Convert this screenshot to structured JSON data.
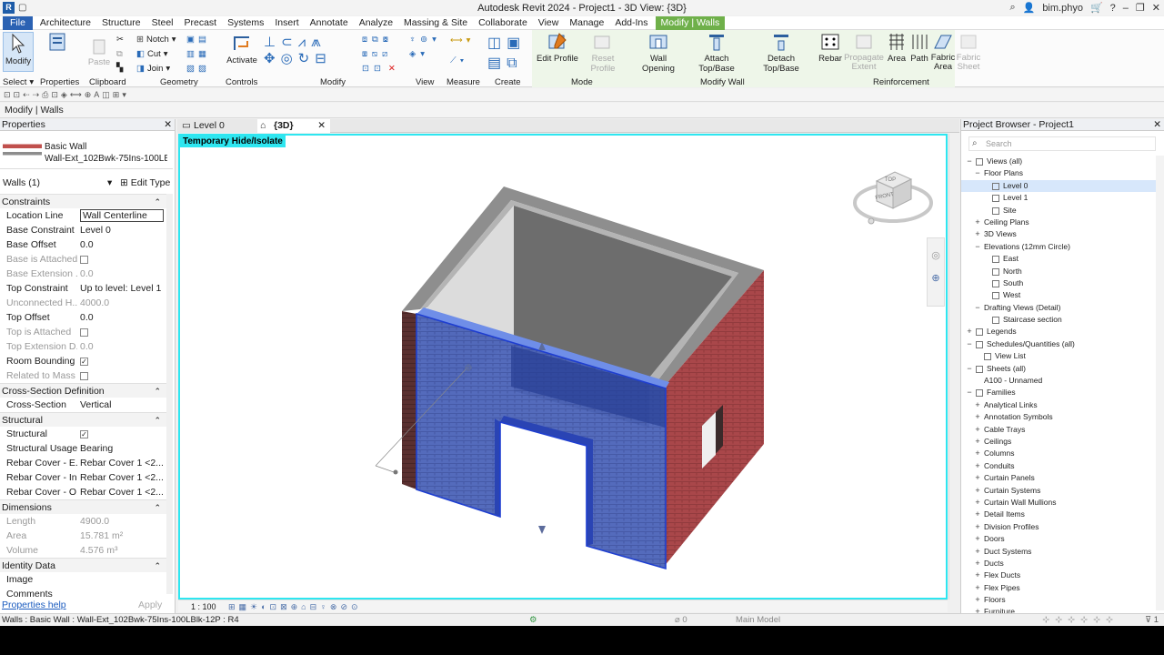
{
  "window": {
    "title": "Autodesk Revit 2024 - Project1 - 3D View: {3D}",
    "user": "bim.phyo",
    "logo": "R"
  },
  "menu": [
    "File",
    "Architecture",
    "Structure",
    "Steel",
    "Precast",
    "Systems",
    "Insert",
    "Annotate",
    "Analyze",
    "Massing & Site",
    "Collaborate",
    "View",
    "Manage",
    "Add-Ins",
    "Modify | Walls"
  ],
  "ribbon": {
    "groups": {
      "select": "Select",
      "properties": "Properties",
      "clipboard": "Clipboard",
      "geometry": "Geometry",
      "controls": "Controls",
      "modify": "Modify",
      "view": "View",
      "measure": "Measure",
      "create": "Create",
      "mode": "Mode",
      "modify_wall": "Modify Wall",
      "reinforcement": "Reinforcement"
    },
    "buttons": {
      "modify": "Modify",
      "paste": "Paste",
      "notch": "Notch",
      "cut": "Cut",
      "join": "Join",
      "activate": "Activate",
      "edit_profile": "Edit Profile",
      "reset_profile": "Reset Profile",
      "wall_opening": "Wall Opening",
      "attach": "Attach Top/Base",
      "detach": "Detach Top/Base",
      "rebar": "Rebar",
      "propagate": "Propagate Extent",
      "area": "Area",
      "path": "Path",
      "fabric_area": "Fabric Area",
      "fabric_sheet": "Fabric Sheet"
    }
  },
  "optionbar": "Modify | Walls",
  "properties": {
    "title": "Properties",
    "type_family": "Basic Wall",
    "type_name": "Wall-Ext_102Bwk-75Ins-100LBlk-12P",
    "filter": "Walls (1)",
    "edit_type": "Edit Type",
    "rows": [
      {
        "kind": "sec",
        "k": "Constraints"
      },
      {
        "k": "Location Line",
        "v": "Wall Centerline",
        "input": true
      },
      {
        "k": "Base Constraint",
        "v": "Level 0"
      },
      {
        "k": "Base Offset",
        "v": "0.0"
      },
      {
        "k": "Base is Attached",
        "v": "",
        "cb": "",
        "dim": true
      },
      {
        "k": "Base Extension ...",
        "v": "0.0",
        "dim": true
      },
      {
        "k": "Top Constraint",
        "v": "Up to level: Level 1"
      },
      {
        "k": "Unconnected H...",
        "v": "4000.0",
        "dim": true
      },
      {
        "k": "Top Offset",
        "v": "0.0"
      },
      {
        "k": "Top is Attached",
        "v": "",
        "cb": "",
        "dim": true
      },
      {
        "k": "Top Extension D...",
        "v": "0.0",
        "dim": true
      },
      {
        "k": "Room Bounding",
        "v": "",
        "cb": "✓"
      },
      {
        "k": "Related to Mass",
        "v": "",
        "cb": "",
        "dim": true
      },
      {
        "kind": "sec",
        "k": "Cross-Section Definition"
      },
      {
        "k": "Cross-Section",
        "v": "Vertical"
      },
      {
        "kind": "sec",
        "k": "Structural"
      },
      {
        "k": "Structural",
        "v": "",
        "cb": "✓"
      },
      {
        "k": "Structural Usage",
        "v": "Bearing"
      },
      {
        "k": "Rebar Cover - E...",
        "v": "Rebar Cover 1 <2..."
      },
      {
        "k": "Rebar Cover - In...",
        "v": "Rebar Cover 1 <2..."
      },
      {
        "k": "Rebar Cover - O...",
        "v": "Rebar Cover 1 <2..."
      },
      {
        "kind": "sec",
        "k": "Dimensions"
      },
      {
        "k": "Length",
        "v": "4900.0",
        "dim": true
      },
      {
        "k": "Area",
        "v": "15.781 m²",
        "dim": true
      },
      {
        "k": "Volume",
        "v": "4.576 m³",
        "dim": true
      },
      {
        "kind": "sec",
        "k": "Identity Data"
      },
      {
        "k": "Image",
        "v": ""
      },
      {
        "k": "Comments",
        "v": ""
      }
    ],
    "help": "Properties help",
    "apply": "Apply"
  },
  "view": {
    "tabs": [
      "Level 0",
      "{3D}"
    ],
    "banner": "Temporary Hide/Isolate",
    "scale": "1 : 100",
    "cube_top": "TOP",
    "cube_front": "FRONT"
  },
  "browser": {
    "title": "Project Browser - Project1",
    "search": "Search",
    "items": [
      {
        "l": 0,
        "t": "-",
        "i": "views",
        "s": "Views (all)"
      },
      {
        "l": 1,
        "t": "-",
        "s": "Floor Plans"
      },
      {
        "l": 2,
        "i": "view",
        "s": "Level 0",
        "sel": true
      },
      {
        "l": 2,
        "i": "view",
        "s": "Level 1"
      },
      {
        "l": 2,
        "i": "view",
        "s": "Site"
      },
      {
        "l": 1,
        "t": "+",
        "s": "Ceiling Plans"
      },
      {
        "l": 1,
        "t": "+",
        "s": "3D Views"
      },
      {
        "l": 1,
        "t": "-",
        "s": "Elevations (12mm Circle)"
      },
      {
        "l": 2,
        "i": "view",
        "s": "East"
      },
      {
        "l": 2,
        "i": "view",
        "s": "North"
      },
      {
        "l": 2,
        "i": "view",
        "s": "South"
      },
      {
        "l": 2,
        "i": "view",
        "s": "West"
      },
      {
        "l": 1,
        "t": "-",
        "s": "Drafting Views (Detail)"
      },
      {
        "l": 2,
        "i": "view",
        "s": "Staircase section"
      },
      {
        "l": 0,
        "t": "+",
        "i": "views",
        "s": "Legends"
      },
      {
        "l": 0,
        "t": "-",
        "i": "views",
        "s": "Schedules/Quantities (all)"
      },
      {
        "l": 1,
        "i": "view",
        "s": "View List"
      },
      {
        "l": 0,
        "t": "-",
        "i": "views",
        "s": "Sheets (all)"
      },
      {
        "l": 1,
        "s": "A100 - Unnamed"
      },
      {
        "l": 0,
        "t": "-",
        "i": "views",
        "s": "Families"
      },
      {
        "l": 1,
        "t": "+",
        "s": "Analytical Links"
      },
      {
        "l": 1,
        "t": "+",
        "s": "Annotation Symbols"
      },
      {
        "l": 1,
        "t": "+",
        "s": "Cable Trays"
      },
      {
        "l": 1,
        "t": "+",
        "s": "Ceilings"
      },
      {
        "l": 1,
        "t": "+",
        "s": "Columns"
      },
      {
        "l": 1,
        "t": "+",
        "s": "Conduits"
      },
      {
        "l": 1,
        "t": "+",
        "s": "Curtain Panels"
      },
      {
        "l": 1,
        "t": "+",
        "s": "Curtain Systems"
      },
      {
        "l": 1,
        "t": "+",
        "s": "Curtain Wall Mullions"
      },
      {
        "l": 1,
        "t": "+",
        "s": "Detail Items"
      },
      {
        "l": 1,
        "t": "+",
        "s": "Division Profiles"
      },
      {
        "l": 1,
        "t": "+",
        "s": "Doors"
      },
      {
        "l": 1,
        "t": "+",
        "s": "Duct Systems"
      },
      {
        "l": 1,
        "t": "+",
        "s": "Ducts"
      },
      {
        "l": 1,
        "t": "+",
        "s": "Flex Ducts"
      },
      {
        "l": 1,
        "t": "+",
        "s": "Flex Pipes"
      },
      {
        "l": 1,
        "t": "+",
        "s": "Floors"
      },
      {
        "l": 1,
        "t": "+",
        "s": "Furniture"
      }
    ]
  },
  "status": {
    "text": "Walls : Basic Wall : Wall-Ext_102Bwk-75Ins-100LBlk-12P : R4",
    "model": "Main Model",
    "sel0": "0",
    "filter": "1"
  },
  "colors": {
    "accent": "#2b62b3",
    "context": "#6fb04a",
    "isolate": "#2ee6f0",
    "brick": "#a9474a",
    "select": "#3d6fe0"
  }
}
